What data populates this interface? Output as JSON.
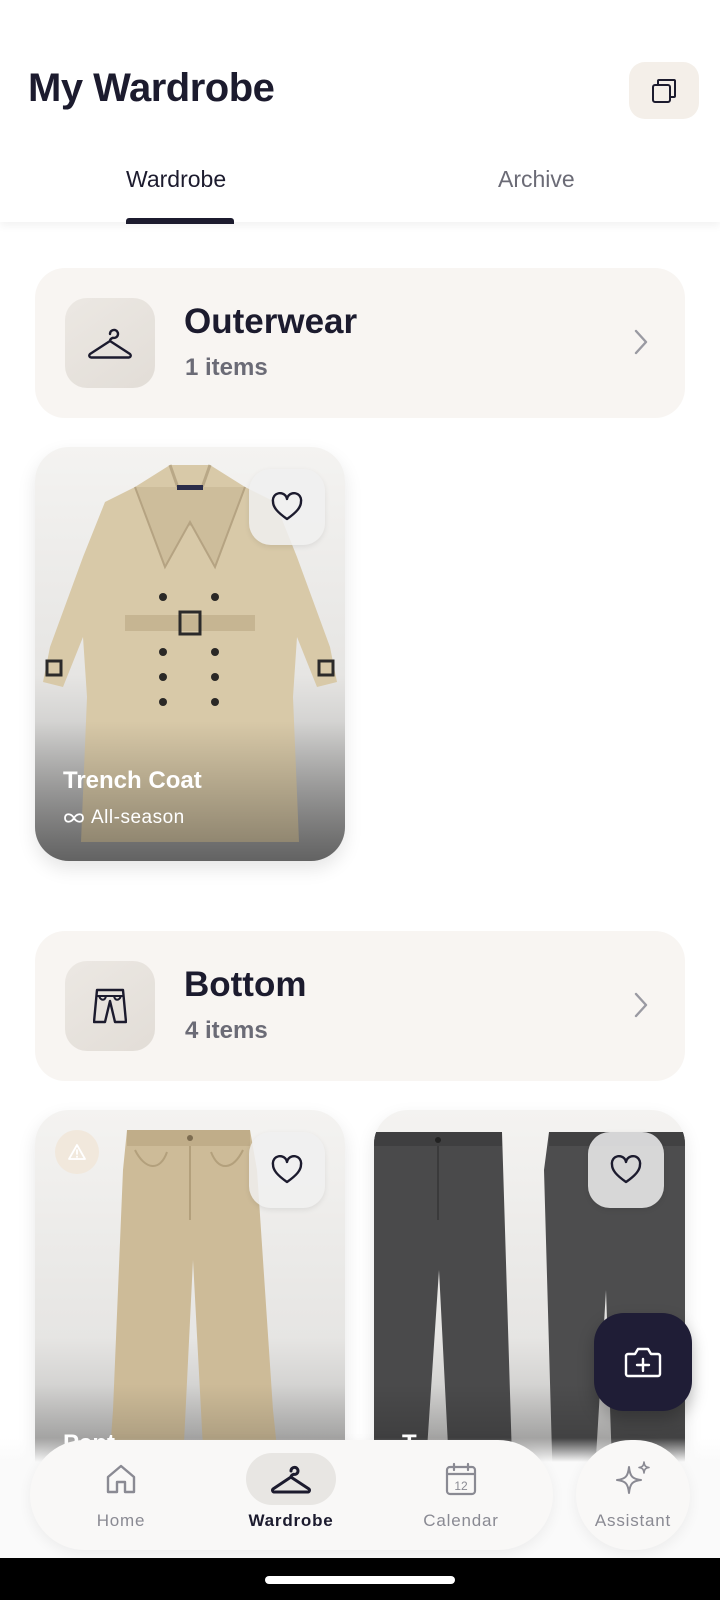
{
  "header": {
    "title": "My Wardrobe",
    "action_icon": "duplicate-icon",
    "tabs": [
      {
        "label": "Wardrobe",
        "active": true
      },
      {
        "label": "Archive",
        "active": false
      }
    ]
  },
  "categories": [
    {
      "name": "Outerwear",
      "count": "1 items",
      "icon": "hanger-icon",
      "items": [
        {
          "name": "Trench Coat",
          "season": "All-season",
          "favorite": false
        }
      ]
    },
    {
      "name": "Bottom",
      "count": "4 items",
      "icon": "pants-icon",
      "items": [
        {
          "name": "Pants",
          "visible_name": "Pant",
          "favorite": false,
          "warning": true
        },
        {
          "name": "Trousers",
          "visible_name": "T",
          "favorite": false
        }
      ]
    }
  ],
  "fab": {
    "icon": "add-photo-icon"
  },
  "nav": {
    "items": [
      {
        "label": "Home",
        "icon": "home-icon",
        "active": false
      },
      {
        "label": "Wardrobe",
        "icon": "hanger-icon",
        "active": true
      },
      {
        "label": "Calendar",
        "icon": "calendar-icon",
        "active": false,
        "day": "12"
      }
    ],
    "assistant": {
      "label": "Assistant",
      "icon": "sparkle-icon"
    }
  },
  "colors": {
    "primary": "#1c1b2e",
    "category_bg": "#f8f5f2",
    "secondary_text": "#6b6b76",
    "fab": "#1f1d36"
  }
}
